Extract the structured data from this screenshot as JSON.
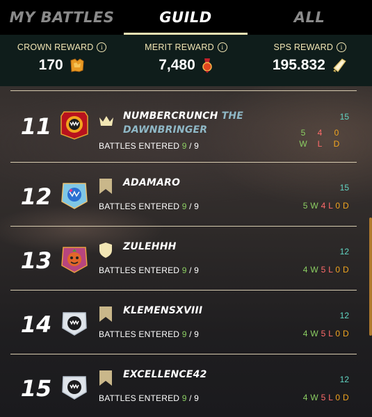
{
  "tabs": [
    {
      "label": "MY BATTLES",
      "active": false
    },
    {
      "label": "GUILD",
      "active": true
    },
    {
      "label": "ALL",
      "active": false
    }
  ],
  "rewards": [
    {
      "label": "CROWN REWARD",
      "value": "170",
      "icon": "crown-token-icon"
    },
    {
      "label": "MERIT REWARD",
      "value": "7,480",
      "icon": "merit-medal-icon"
    },
    {
      "label": "SPS REWARD",
      "value": "195.832",
      "icon": "sps-token-icon"
    }
  ],
  "info_glyph": "i",
  "rows": [
    {
      "rank": "11",
      "name": "NUMBERCRUNCH",
      "title": "THE DAWNBRINGER",
      "rank_icon": "crown-icon",
      "battles_label": "BATTLES ENTERED",
      "battles_done": "9",
      "battles_sep": " / ",
      "battles_total": "9",
      "score": "15",
      "wins": "5",
      "losses": "4",
      "draws": "0",
      "w": "W",
      "l": "L",
      "d": "D"
    },
    {
      "rank": "12",
      "name": "ADAMARO",
      "title": "",
      "rank_icon": "banner-icon",
      "battles_label": "BATTLES ENTERED",
      "battles_done": "9",
      "battles_sep": " / ",
      "battles_total": "9",
      "score": "15",
      "wins": "5 W",
      "losses": "4 L",
      "draws": "0 D"
    },
    {
      "rank": "13",
      "name": "ZULEHHH",
      "title": "",
      "rank_icon": "shield-icon",
      "battles_label": "BATTLES ENTERED",
      "battles_done": "9",
      "battles_sep": " / ",
      "battles_total": "9",
      "score": "12",
      "wins": "4 W",
      "losses": "5 L",
      "draws": "0 D"
    },
    {
      "rank": "14",
      "name": "KLEMENSXVIII",
      "title": "",
      "rank_icon": "banner-icon",
      "battles_label": "BATTLES ENTERED",
      "battles_done": "9",
      "battles_sep": " / ",
      "battles_total": "9",
      "score": "12",
      "wins": "4 W",
      "losses": "5 L",
      "draws": "0 D"
    },
    {
      "rank": "15",
      "name": "EXCELLENCE42",
      "title": "",
      "rank_icon": "banner-icon",
      "battles_label": "BATTLES ENTERED",
      "battles_done": "9",
      "battles_sep": " / ",
      "battles_total": "9",
      "score": "12",
      "wins": "4 W",
      "losses": "5 L",
      "draws": "0 D"
    }
  ],
  "colors": {
    "accent": "#f2e6b4",
    "win": "#8ccf63",
    "loss": "#ff6b6b",
    "draw": "#f2a61f",
    "score": "#62d6c4",
    "title": "#8fb8c6"
  }
}
